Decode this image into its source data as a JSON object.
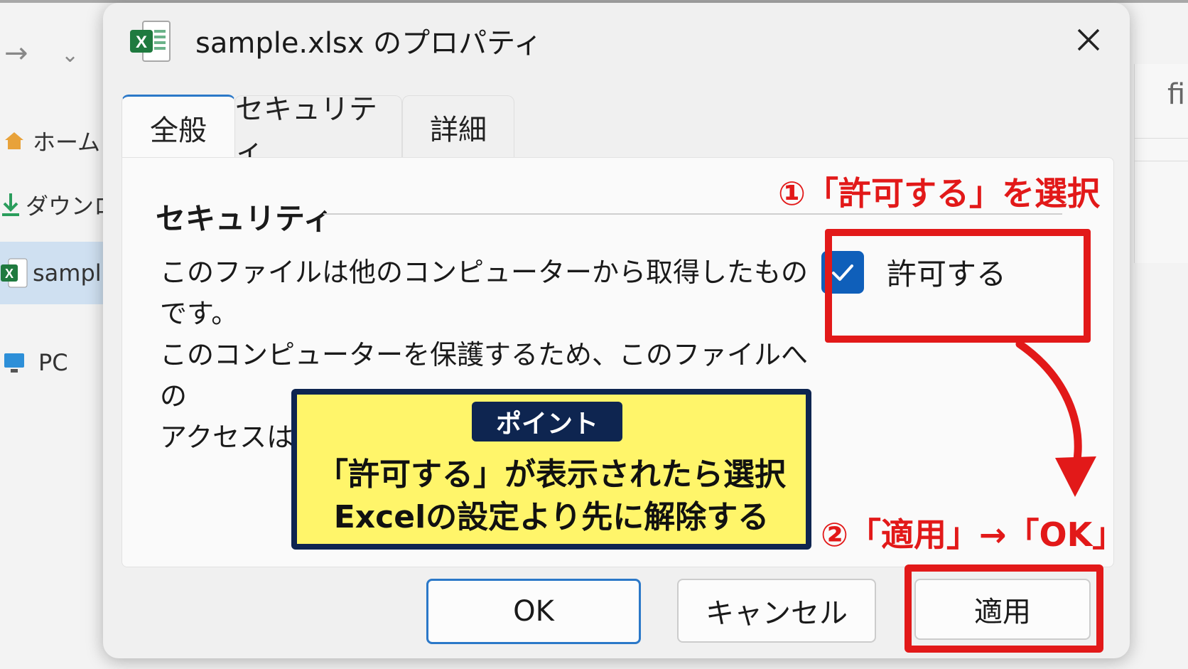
{
  "explorer": {
    "sidebar": [
      {
        "label": "ホーム",
        "icon": "home-icon"
      },
      {
        "label": "ダウンロ",
        "icon": "download-icon"
      },
      {
        "label": "sampl",
        "icon": "excel-file-icon",
        "selected": true
      },
      {
        "label": "PC",
        "icon": "monitor-icon"
      }
    ],
    "right_pane_text": "fi"
  },
  "dialog": {
    "title": "sample.xlsx のプロパティ",
    "tabs": [
      {
        "label": "全般",
        "active": true
      },
      {
        "label": "セキュリティ",
        "active": false
      },
      {
        "label": "詳細",
        "active": false
      }
    ],
    "section_title": "セキュリティ",
    "message_lines": [
      "このファイルは他のコンピューターから取得したものです。",
      "このコンピューターを保護するため、このファイルへの",
      "アクセスはブロックされる可能性があります。"
    ],
    "checkbox": {
      "label": "許可する",
      "checked": true
    },
    "buttons": {
      "ok": "OK",
      "cancel": "キャンセル",
      "apply": "適用"
    }
  },
  "annotations": {
    "step1": "①「許可する」を選択",
    "step2": "②「適用」→「OK」",
    "point": {
      "tag": "ポイント",
      "line1": "「許可する」が表示されたら選択",
      "line2": "Excelの設定より先に解除する"
    },
    "accent_color": "#e21919",
    "point_bg": "#fff56a",
    "point_border": "#0e2550"
  }
}
